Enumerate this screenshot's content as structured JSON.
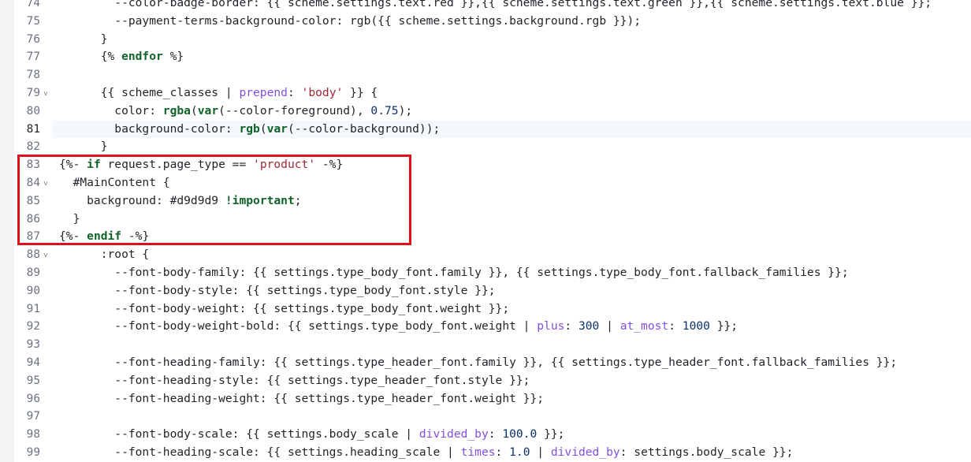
{
  "colors": {
    "keyword": "#116329",
    "filter": "#8250df",
    "string": "#a1263a",
    "number": "#0a3069",
    "text": "#1f2328",
    "line_number": "#6b7280",
    "highlight_box": "#e0101a",
    "active_line_bg": "#f2f8fc"
  },
  "fold_icon": "chevron-down-icon",
  "lines": [
    {
      "n": "74",
      "fold": false,
      "active": false,
      "tokens": [
        {
          "t": "txt",
          "v": "        --color-badge-border: {{ scheme.settings.text.red }},{{ scheme.settings.text.green }},{{ scheme.settings.text.blue }};"
        }
      ]
    },
    {
      "n": "75",
      "fold": false,
      "active": false,
      "tokens": [
        {
          "t": "txt",
          "v": "        --payment-terms-background-color: rgb({{ scheme.settings.background.rgb }});"
        }
      ]
    },
    {
      "n": "76",
      "fold": false,
      "active": false,
      "tokens": [
        {
          "t": "txt",
          "v": "      }"
        }
      ]
    },
    {
      "n": "77",
      "fold": false,
      "active": false,
      "tokens": [
        {
          "t": "txt",
          "v": "      {% "
        },
        {
          "t": "kw",
          "v": "endfor"
        },
        {
          "t": "txt",
          "v": " %}"
        }
      ]
    },
    {
      "n": "78",
      "fold": false,
      "active": false,
      "tokens": []
    },
    {
      "n": "79",
      "fold": true,
      "active": false,
      "tokens": [
        {
          "t": "txt",
          "v": "      {{ scheme_classes | "
        },
        {
          "t": "flt",
          "v": "prepend"
        },
        {
          "t": "txt",
          "v": ": "
        },
        {
          "t": "str",
          "v": "'body'"
        },
        {
          "t": "txt",
          "v": " }} {"
        }
      ]
    },
    {
      "n": "80",
      "fold": false,
      "active": false,
      "tokens": [
        {
          "t": "txt",
          "v": "        color: "
        },
        {
          "t": "fn",
          "v": "rgba"
        },
        {
          "t": "txt",
          "v": "("
        },
        {
          "t": "fn",
          "v": "var"
        },
        {
          "t": "txt",
          "v": "(--color-foreground), "
        },
        {
          "t": "num",
          "v": "0.75"
        },
        {
          "t": "txt",
          "v": ");"
        }
      ]
    },
    {
      "n": "81",
      "fold": false,
      "active": true,
      "tokens": [
        {
          "t": "txt",
          "v": "        background-color: "
        },
        {
          "t": "fn",
          "v": "rgb"
        },
        {
          "t": "txt",
          "v": "("
        },
        {
          "t": "fn",
          "v": "var"
        },
        {
          "t": "txt",
          "v": "(--color-background));"
        }
      ]
    },
    {
      "n": "82",
      "fold": false,
      "active": false,
      "tokens": [
        {
          "t": "txt",
          "v": "      }"
        }
      ]
    },
    {
      "n": "83",
      "fold": false,
      "active": false,
      "tokens": [
        {
          "t": "txt",
          "v": "{%- "
        },
        {
          "t": "kw",
          "v": "if"
        },
        {
          "t": "txt",
          "v": " request.page_type == "
        },
        {
          "t": "str",
          "v": "'product'"
        },
        {
          "t": "txt",
          "v": " -%}"
        }
      ]
    },
    {
      "n": "84",
      "fold": true,
      "active": false,
      "tokens": [
        {
          "t": "txt",
          "v": "  #MainContent {"
        }
      ]
    },
    {
      "n": "85",
      "fold": false,
      "active": false,
      "tokens": [
        {
          "t": "txt",
          "v": "    background: #d9d9d9 "
        },
        {
          "t": "kw",
          "v": "!important"
        },
        {
          "t": "txt",
          "v": ";"
        }
      ]
    },
    {
      "n": "86",
      "fold": false,
      "active": false,
      "tokens": [
        {
          "t": "txt",
          "v": "  }"
        }
      ]
    },
    {
      "n": "87",
      "fold": false,
      "active": false,
      "tokens": [
        {
          "t": "txt",
          "v": "{%- "
        },
        {
          "t": "kw",
          "v": "endif"
        },
        {
          "t": "txt",
          "v": " -%}"
        }
      ]
    },
    {
      "n": "88",
      "fold": true,
      "active": false,
      "tokens": [
        {
          "t": "txt",
          "v": "      :root {"
        }
      ]
    },
    {
      "n": "89",
      "fold": false,
      "active": false,
      "tokens": [
        {
          "t": "txt",
          "v": "        --font-body-family: {{ settings.type_body_font.family }}, {{ settings.type_body_font.fallback_families }};"
        }
      ]
    },
    {
      "n": "90",
      "fold": false,
      "active": false,
      "tokens": [
        {
          "t": "txt",
          "v": "        --font-body-style: {{ settings.type_body_font.style }};"
        }
      ]
    },
    {
      "n": "91",
      "fold": false,
      "active": false,
      "tokens": [
        {
          "t": "txt",
          "v": "        --font-body-weight: {{ settings.type_body_font.weight }};"
        }
      ]
    },
    {
      "n": "92",
      "fold": false,
      "active": false,
      "tokens": [
        {
          "t": "txt",
          "v": "        --font-body-weight-bold: {{ settings.type_body_font.weight | "
        },
        {
          "t": "flt",
          "v": "plus"
        },
        {
          "t": "txt",
          "v": ": "
        },
        {
          "t": "num",
          "v": "300"
        },
        {
          "t": "txt",
          "v": " | "
        },
        {
          "t": "flt",
          "v": "at_most"
        },
        {
          "t": "txt",
          "v": ": "
        },
        {
          "t": "num",
          "v": "1000"
        },
        {
          "t": "txt",
          "v": " }};"
        }
      ]
    },
    {
      "n": "93",
      "fold": false,
      "active": false,
      "tokens": []
    },
    {
      "n": "94",
      "fold": false,
      "active": false,
      "tokens": [
        {
          "t": "txt",
          "v": "        --font-heading-family: {{ settings.type_header_font.family }}, {{ settings.type_header_font.fallback_families }};"
        }
      ]
    },
    {
      "n": "95",
      "fold": false,
      "active": false,
      "tokens": [
        {
          "t": "txt",
          "v": "        --font-heading-style: {{ settings.type_header_font.style }};"
        }
      ]
    },
    {
      "n": "96",
      "fold": false,
      "active": false,
      "tokens": [
        {
          "t": "txt",
          "v": "        --font-heading-weight: {{ settings.type_header_font.weight }};"
        }
      ]
    },
    {
      "n": "97",
      "fold": false,
      "active": false,
      "tokens": []
    },
    {
      "n": "98",
      "fold": false,
      "active": false,
      "tokens": [
        {
          "t": "txt",
          "v": "        --font-body-scale: {{ settings.body_scale | "
        },
        {
          "t": "flt",
          "v": "divided_by"
        },
        {
          "t": "txt",
          "v": ": "
        },
        {
          "t": "num",
          "v": "100.0"
        },
        {
          "t": "txt",
          "v": " }};"
        }
      ]
    },
    {
      "n": "99",
      "fold": false,
      "active": false,
      "tokens": [
        {
          "t": "txt",
          "v": "        --font-heading-scale: {{ settings.heading_scale | "
        },
        {
          "t": "flt",
          "v": "times"
        },
        {
          "t": "txt",
          "v": ": "
        },
        {
          "t": "num",
          "v": "1.0"
        },
        {
          "t": "txt",
          "v": " | "
        },
        {
          "t": "flt",
          "v": "divided_by"
        },
        {
          "t": "txt",
          "v": ": settings.body_scale }};"
        }
      ]
    }
  ]
}
